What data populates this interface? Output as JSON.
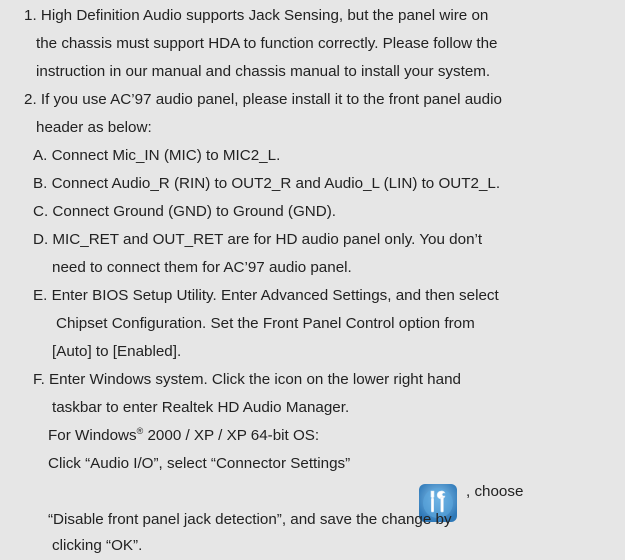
{
  "notes": {
    "item1": {
      "line1": "1. High Definition Audio supports Jack Sensing, but the panel wire on",
      "line2": "the chassis must support HDA to function correctly. Please follow the",
      "line3": "instruction in our manual and chassis manual to install your system."
    },
    "item2": {
      "line1": "2. If you use AC’97 audio panel, please install it to the front panel audio",
      "line2": "header as below:"
    },
    "steps": {
      "a": "A. Connect Mic_IN (MIC) to MIC2_L.",
      "b": "B. Connect Audio_R (RIN) to OUT2_R and Audio_L (LIN) to OUT2_L.",
      "c": "C. Connect Ground (GND) to Ground (GND).",
      "d1": "D. MIC_RET and OUT_RET are for HD audio panel only. You don’t",
      "d2": "need to connect them for AC’97 audio panel.",
      "e1": "E. Enter BIOS Setup Utility. Enter Advanced Settings, and then select",
      "e2": "Chipset Configuration. Set the Front Panel Control option from",
      "e3": "[Auto] to [Enabled].",
      "f1": "F. Enter Windows system. Click the icon on the lower right hand",
      "f2": "taskbar to enter Realtek HD Audio Manager.",
      "f3_prefix": "For Windows",
      "f3_reg": "®",
      "f3_suffix": " 2000 / XP / XP 64-bit OS:",
      "f4_before": "Click “Audio I/O”, select “Connector Settings”",
      "f4_after": ", choose",
      "f5": "“Disable front panel jack detection”, and save the change by",
      "f6": "clicking “OK”."
    }
  },
  "icon": {
    "name": "connector-settings-icon",
    "bg_color": "#4a93c9",
    "tool_color": "#ffffff"
  }
}
